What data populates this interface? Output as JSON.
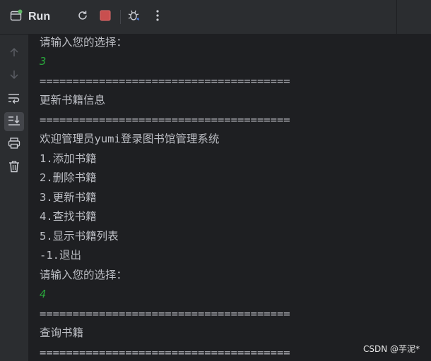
{
  "toolbar": {
    "title": "Run",
    "icons": [
      "run-window-icon",
      "rerun-icon",
      "stop-icon",
      "debug-icon",
      "more-icon"
    ]
  },
  "sidebar": {
    "icons": [
      "arrow-up-icon",
      "arrow-down-icon",
      "soft-wrap-icon",
      "scroll-to-end-icon",
      "print-icon",
      "trash-icon"
    ]
  },
  "console": {
    "lines": [
      {
        "text": "请输入您的选择：",
        "kind": "output"
      },
      {
        "text": "3",
        "kind": "input"
      },
      {
        "text": "======================================",
        "kind": "output"
      },
      {
        "text": "更新书籍信息",
        "kind": "output"
      },
      {
        "text": "======================================",
        "kind": "output"
      },
      {
        "text": "欢迎管理员yumi登录图书馆管理系统",
        "kind": "output"
      },
      {
        "text": "1.添加书籍",
        "kind": "output"
      },
      {
        "text": "2.删除书籍",
        "kind": "output"
      },
      {
        "text": "3.更新书籍",
        "kind": "output"
      },
      {
        "text": "4.查找书籍",
        "kind": "output"
      },
      {
        "text": "5.显示书籍列表",
        "kind": "output"
      },
      {
        "text": "-1.退出",
        "kind": "output"
      },
      {
        "text": "请输入您的选择：",
        "kind": "output"
      },
      {
        "text": "4",
        "kind": "input"
      },
      {
        "text": "======================================",
        "kind": "output"
      },
      {
        "text": "查询书籍",
        "kind": "output"
      },
      {
        "text": "======================================",
        "kind": "output"
      }
    ]
  },
  "watermark": "CSDN @芋泥*",
  "colors": {
    "background": "#1e1f22",
    "panel": "#2b2d30",
    "text": "#bcbec4",
    "input_text": "#29a33b",
    "stop_red": "#c94f4f"
  }
}
